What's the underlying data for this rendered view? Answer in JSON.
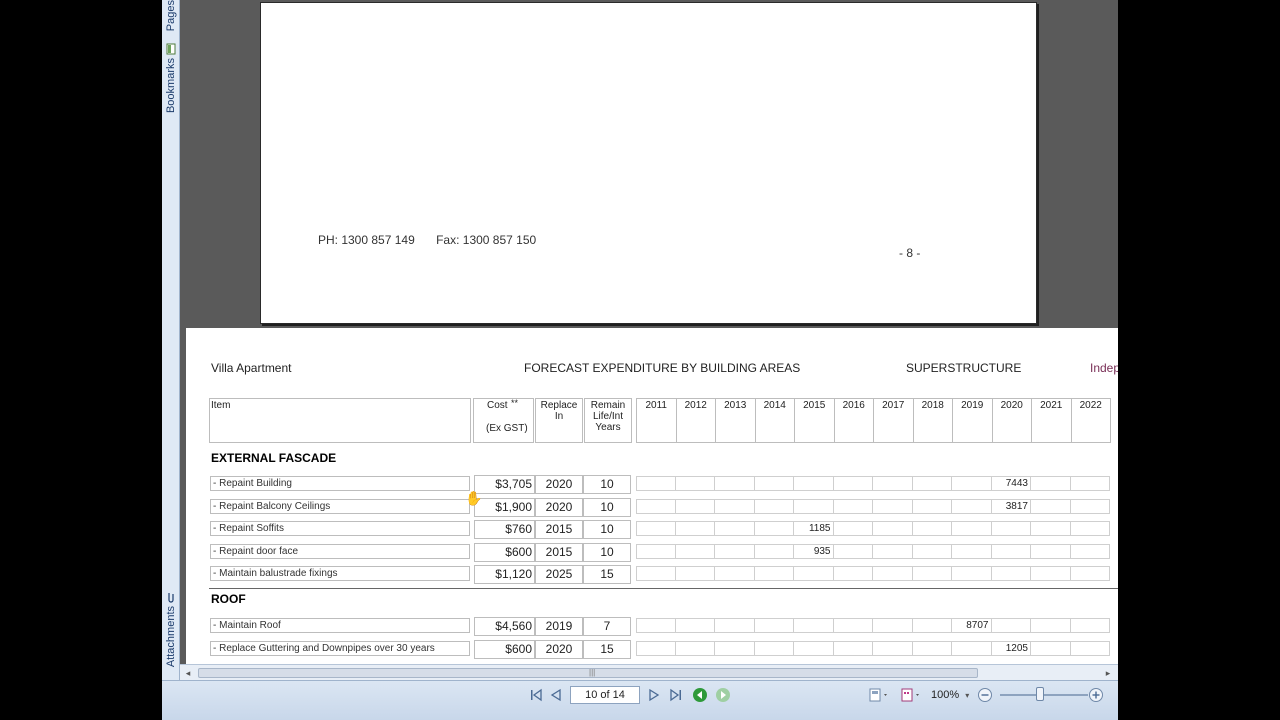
{
  "nav_panel": {
    "pages_label": "Pages",
    "bookmarks_label": "Bookmarks",
    "attachments_label": "Attachments"
  },
  "page8": {
    "phone": "PH: 1300 857 149",
    "fax": "Fax: 1300 857 150",
    "page_number": "- 8 -"
  },
  "page9": {
    "header_left": "Villa Apartment",
    "header_center": "FORECAST EXPENDITURE BY BUILDING AREAS",
    "header_right": "SUPERSTRUCTURE",
    "header_cut": "Indep",
    "columns": {
      "item": "Item",
      "cost": "Cost",
      "cost_marker": "**",
      "cost_sub": "(Ex GST)",
      "replace_line1": "Replace",
      "replace_line2": "In",
      "remain_line1": "Remain",
      "remain_line2": "Life/Int",
      "remain_line3": "Years"
    },
    "years": [
      "2011",
      "2012",
      "2013",
      "2014",
      "2015",
      "2016",
      "2017",
      "2018",
      "2019",
      "2020",
      "2021",
      "2022"
    ],
    "sections": [
      {
        "title": "EXTERNAL FASCADE",
        "rows": [
          {
            "item": "- Repaint Building",
            "cost": "$3,705",
            "replace": "2020",
            "remain": "10",
            "year_col": 9,
            "amount": "7443"
          },
          {
            "item": "- Repaint Balcony Ceilings",
            "cost": "$1,900",
            "replace": "2020",
            "remain": "10",
            "year_col": 9,
            "amount": "3817"
          },
          {
            "item": "- Repaint Soffits",
            "cost": "$760",
            "replace": "2015",
            "remain": "10",
            "year_col": 4,
            "amount": "1185"
          },
          {
            "item": "- Repaint door face",
            "cost": "$600",
            "replace": "2015",
            "remain": "10",
            "year_col": 4,
            "amount": "935"
          },
          {
            "item": "- Maintain balustrade fixings",
            "cost": "$1,120",
            "replace": "2025",
            "remain": "15",
            "year_col": -1,
            "amount": ""
          }
        ]
      },
      {
        "title": "ROOF",
        "rows": [
          {
            "item": "- Maintain Roof",
            "cost": "$4,560",
            "replace": "2019",
            "remain": "7",
            "year_col": 8,
            "amount": "8707"
          },
          {
            "item": "- Replace Guttering and Downpipes over 30 years",
            "cost": "$600",
            "replace": "2020",
            "remain": "15",
            "year_col": 9,
            "amount": "1205"
          }
        ]
      }
    ]
  },
  "toolbar": {
    "page_indicator": "10 of 14",
    "zoom": "100%"
  },
  "icons": {
    "first": "first-page-icon",
    "prev": "previous-page-icon",
    "next": "next-page-icon",
    "last": "last-page-icon",
    "back": "go-back-icon",
    "forward": "go-forward-icon",
    "zoom_out": "zoom-out-icon",
    "zoom_in": "zoom-in-icon"
  },
  "colors": {
    "toolbar": "#c8d7ea",
    "nav_accent": "#1b3b6b",
    "green_nav": "#2e9a3a",
    "header_cut": "#7a2f57"
  }
}
